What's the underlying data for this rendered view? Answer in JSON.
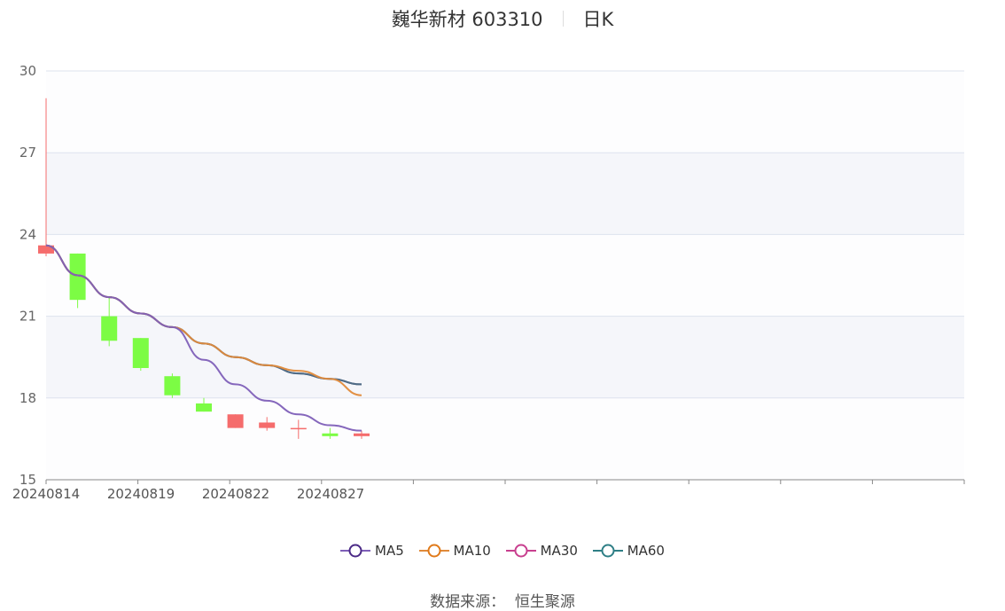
{
  "header": {
    "stock_name": "巍华新材 603310",
    "period": "日K"
  },
  "source": {
    "label": "数据来源：",
    "value": "恒生聚源"
  },
  "colors": {
    "up": "#f56c6c",
    "down": "#7cfc44",
    "ma5": "#7e5fb8",
    "ma10": "#e08a3a",
    "ma30": "#c8408f",
    "ma60": "#2f7f86",
    "grid": "#dde2ee",
    "band": "#f5f6fa"
  },
  "chart_data": {
    "type": "candlestick",
    "ylim": [
      15,
      30
    ],
    "yticks": [
      15,
      18,
      21,
      24,
      27,
      30
    ],
    "x_tick_labels": [
      "20240814",
      "20240819",
      "20240822",
      "20240827"
    ],
    "dates": [
      "20240814",
      "20240815",
      "20240816",
      "20240819",
      "20240820",
      "20240821",
      "20240822",
      "20240823",
      "20240826",
      "20240827",
      "20240828"
    ],
    "ohlc": [
      {
        "open": 23.3,
        "close": 23.6,
        "high": 29.0,
        "low": 23.2
      },
      {
        "open": 23.3,
        "close": 21.6,
        "high": 23.3,
        "low": 21.3
      },
      {
        "open": 21.0,
        "close": 20.1,
        "high": 21.7,
        "low": 19.9
      },
      {
        "open": 20.2,
        "close": 19.1,
        "high": 20.2,
        "low": 19.0
      },
      {
        "open": 18.8,
        "close": 18.1,
        "high": 18.9,
        "low": 18.0
      },
      {
        "open": 17.8,
        "close": 17.5,
        "high": 18.0,
        "low": 17.5
      },
      {
        "open": 16.9,
        "close": 17.4,
        "high": 17.4,
        "low": 16.9
      },
      {
        "open": 16.9,
        "close": 17.1,
        "high": 17.3,
        "low": 16.8
      },
      {
        "open": 16.9,
        "close": 16.9,
        "high": 17.2,
        "low": 16.5
      },
      {
        "open": 16.7,
        "close": 16.6,
        "high": 16.9,
        "low": 16.5
      },
      {
        "open": 16.6,
        "close": 16.7,
        "high": 16.8,
        "low": 16.5
      }
    ],
    "series": [
      {
        "name": "MA5",
        "values": [
          23.6,
          22.5,
          21.7,
          21.1,
          20.6,
          19.4,
          18.5,
          17.9,
          17.4,
          17.0,
          16.8
        ]
      },
      {
        "name": "MA10",
        "values": [
          23.6,
          22.5,
          21.7,
          21.1,
          20.6,
          20.0,
          19.5,
          19.2,
          19.0,
          18.7,
          18.1
        ]
      },
      {
        "name": "MA30",
        "values": [
          23.6,
          22.5,
          21.7,
          21.1,
          20.6,
          20.0,
          19.5,
          19.2,
          18.9,
          18.7,
          18.5
        ]
      },
      {
        "name": "MA60",
        "values": [
          23.6,
          22.5,
          21.7,
          21.1,
          20.6,
          20.0,
          19.5,
          19.2,
          18.9,
          18.7,
          18.5
        ]
      }
    ]
  }
}
